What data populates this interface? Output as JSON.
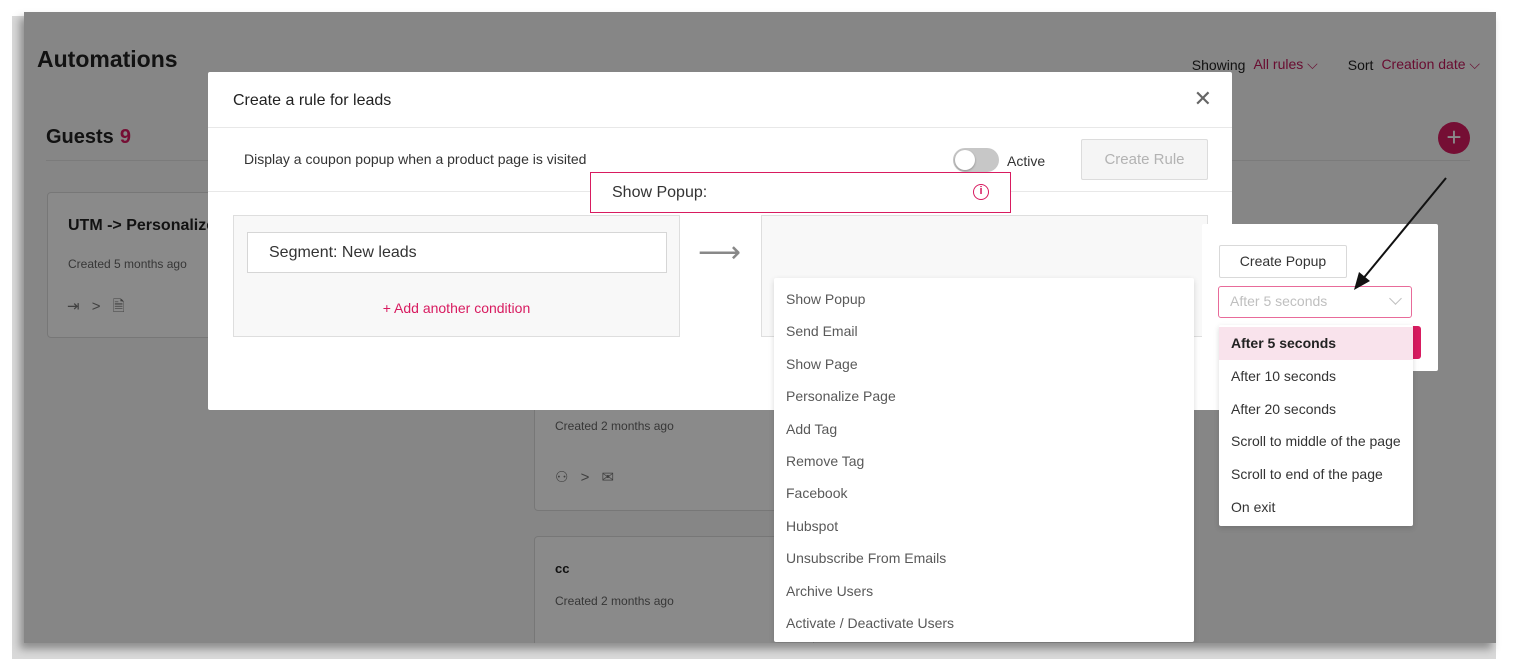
{
  "app": {
    "title": "Automations",
    "showing_label": "Showing",
    "showing_value": "All rules ⌵",
    "sort_label": "Sort",
    "sort_value": "Creation date ⌵",
    "section_title": "Guests",
    "section_count": "9",
    "add_icon": "plus-icon"
  },
  "cards": [
    {
      "title": "UTM -> Personalize",
      "date": "Created 5 months ago",
      "icons": "⇥ > 🗎"
    },
    {
      "title": "",
      "date": "Created 2 months ago",
      "icons": "⚇ > ✉"
    },
    {
      "title": "cc",
      "date": "Created 2 months ago"
    }
  ],
  "modal": {
    "title": "Create a rule for leads",
    "close_icon": "✕",
    "rule_description": "Display a coupon popup when a product page is visited",
    "toggle_label": "Active",
    "toggle_on": false,
    "create_rule_label": "Create Rule",
    "segment_value": "Segment: New leads",
    "add_condition_label": "+ Add another condition",
    "arrow": "⟶",
    "action_value": "Show Popup:",
    "info_icon": "i"
  },
  "action_options": [
    "Show Popup",
    "Send Email",
    "Show Page",
    "Personalize Page",
    "Add Tag",
    "Remove Tag",
    "Facebook",
    "Hubspot",
    "Unsubscribe From Emails",
    "Archive Users",
    "Activate / Deactivate Users"
  ],
  "popup_panel": {
    "create_popup_label": "Create Popup",
    "timing_placeholder": "After 5 seconds",
    "timing_options": [
      "After 5 seconds",
      "After 10 seconds",
      "After 20 seconds",
      "Scroll to middle of the page",
      "Scroll to end of the page",
      "On exit"
    ],
    "selected_index": 0
  },
  "colors": {
    "accent": "#d81b60",
    "overlay": "rgba(0,0,0,0.46)",
    "selected_bg": "#f9e3ec"
  }
}
